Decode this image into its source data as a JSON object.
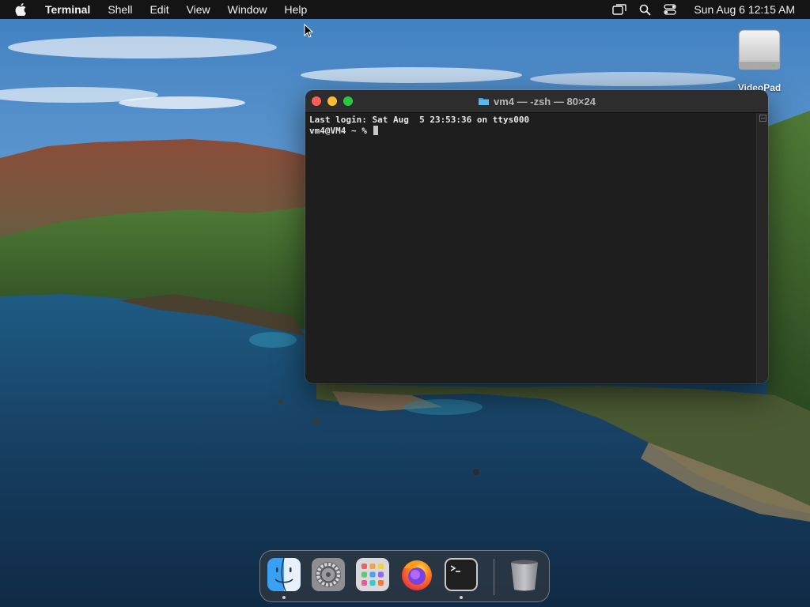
{
  "menubar": {
    "apple_icon": "apple-icon",
    "app_name": "Terminal",
    "menus": [
      "Shell",
      "Edit",
      "View",
      "Window",
      "Help"
    ],
    "status_icons": [
      "screen-mirroring-icon",
      "spotlight-search-icon",
      "control-center-icon"
    ],
    "clock": "Sun Aug 6  12:15 AM"
  },
  "desktop": {
    "disk_label": "VideoPad",
    "disk_icon": "external-drive-icon"
  },
  "terminal": {
    "title": "vm4 — -zsh — 80×24",
    "folder_icon": "folder-icon",
    "lines": [
      "Last login: Sat Aug  5 23:53:36 on ttys000",
      "vm4@VM4 ~ % "
    ]
  },
  "dock": {
    "items": [
      {
        "name": "Finder",
        "icon": "finder-icon",
        "running": true
      },
      {
        "name": "System Preferences",
        "icon": "gear-icon",
        "running": false
      },
      {
        "name": "Launchpad",
        "icon": "launchpad-icon",
        "running": false
      },
      {
        "name": "Firefox",
        "icon": "firefox-icon",
        "running": false
      },
      {
        "name": "Terminal",
        "icon": "terminal-icon",
        "running": true
      },
      {
        "name": "Trash",
        "icon": "trash-icon",
        "running": false
      }
    ]
  },
  "colors": {
    "close": "#ff5f57",
    "minimize": "#febc2e",
    "maximize": "#28c840",
    "menubar": "#141414",
    "terminal_bg": "#1e1e1e"
  }
}
